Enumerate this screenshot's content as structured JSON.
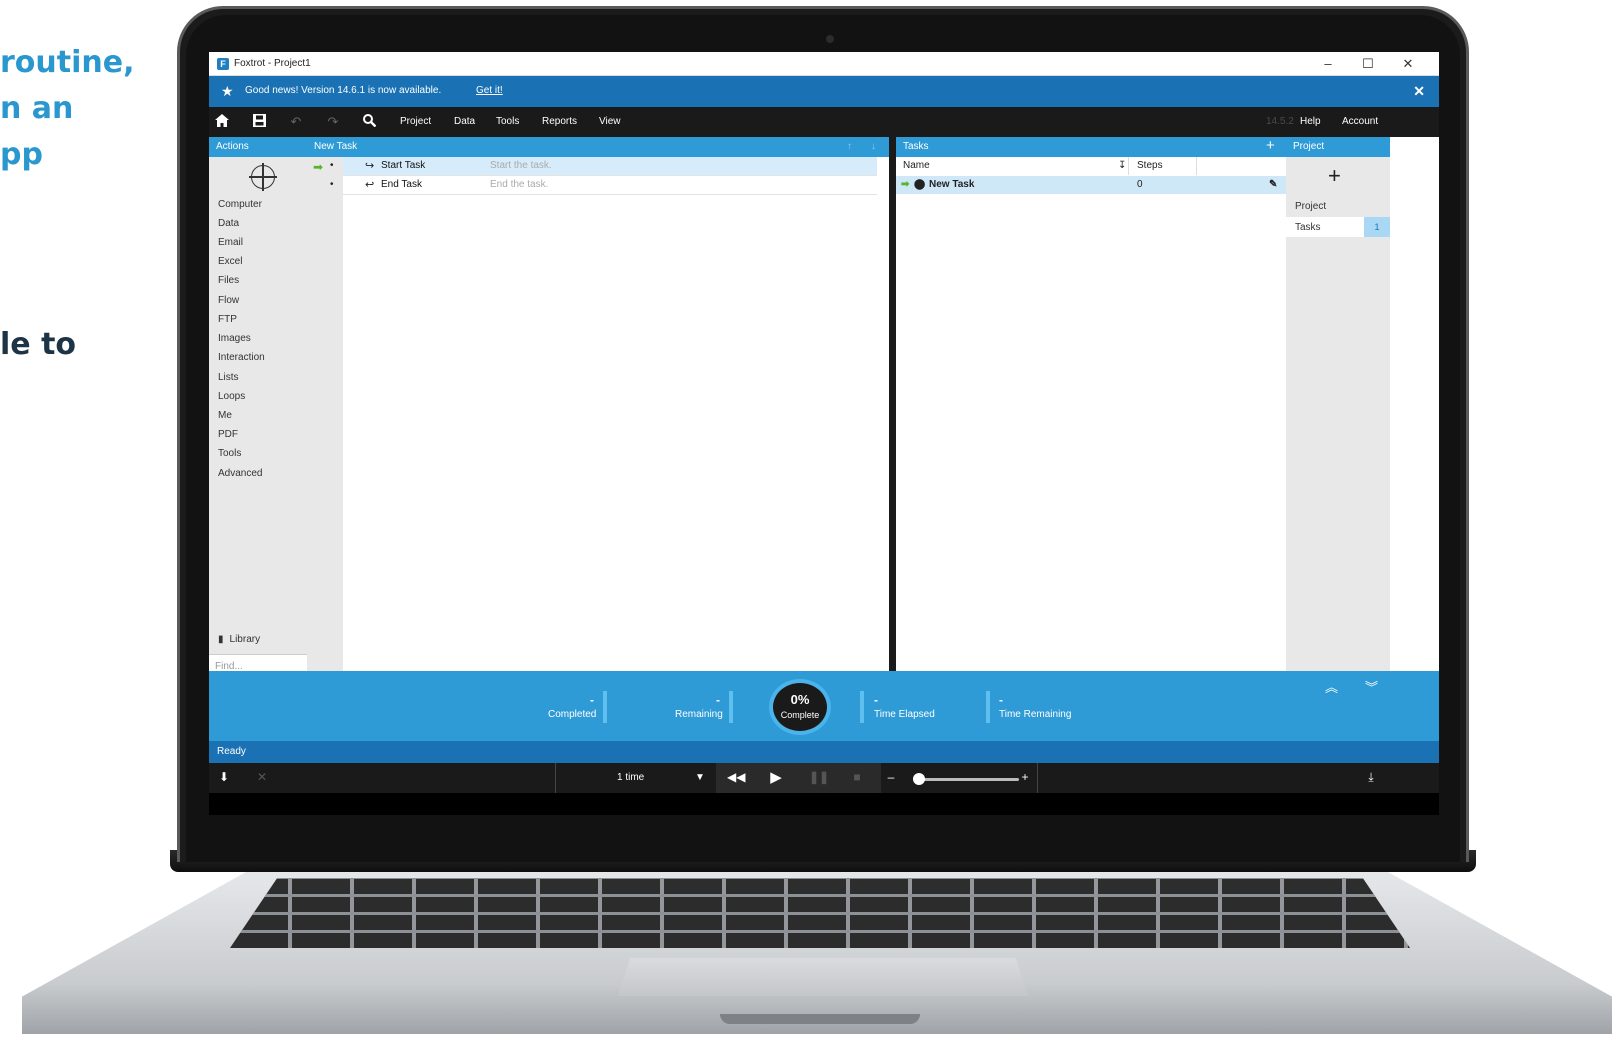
{
  "side_text": {
    "blue_lines": [
      "routine,",
      "n an",
      "pp"
    ],
    "dark_lines": [
      "le to"
    ]
  },
  "window": {
    "title": "Foxtrot - Project1",
    "minimize": "–",
    "maximize": "☐",
    "close": "✕"
  },
  "notify": {
    "text": "Good news! Version 14.6.1 is now available.",
    "link": "Get it!",
    "close": "✕"
  },
  "toolbar": {
    "menus": [
      "Project",
      "Data",
      "Tools",
      "Reports",
      "View"
    ],
    "version": "14.5.2",
    "help": "Help",
    "account": "Account"
  },
  "actions": {
    "header": "Actions",
    "categories": [
      "Computer",
      "Data",
      "Email",
      "Excel",
      "Files",
      "Flow",
      "FTP",
      "Images",
      "Interaction",
      "Lists",
      "Loops",
      "Me",
      "PDF",
      "Tools",
      "Advanced"
    ],
    "library": "Library",
    "find_placeholder": "Find..."
  },
  "steps": {
    "header": "New Task",
    "rows": [
      {
        "name": "Start Task",
        "desc": "Start the task."
      },
      {
        "name": "End Task",
        "desc": "End the task."
      }
    ]
  },
  "tasks": {
    "header": "Tasks",
    "col_name": "Name",
    "col_steps": "Steps",
    "rows": [
      {
        "name": "New Task",
        "steps": "0"
      }
    ]
  },
  "project": {
    "header": "Project",
    "section": "Project",
    "tasks_label": "Tasks",
    "tasks_count": "1"
  },
  "progress": {
    "completed_val": "-",
    "completed_lbl": "Completed",
    "remaining_val": "-",
    "remaining_lbl": "Remaining",
    "percent": "0%",
    "percent_lbl": "Complete",
    "elapsed_val": "-",
    "elapsed_lbl": "Time Elapsed",
    "time_remaining_val": "-",
    "time_remaining_lbl": "Time Remaining"
  },
  "status": "Ready",
  "controls": {
    "run_count": "1 time",
    "speed_minus": "–",
    "speed_plus": "+",
    "speed_level": 0.05
  },
  "colors": {
    "accent": "#2e9ad6",
    "notify": "#1a71b3",
    "toolbar": "#1a1a1a",
    "selected_row": "#cfe8f8"
  }
}
